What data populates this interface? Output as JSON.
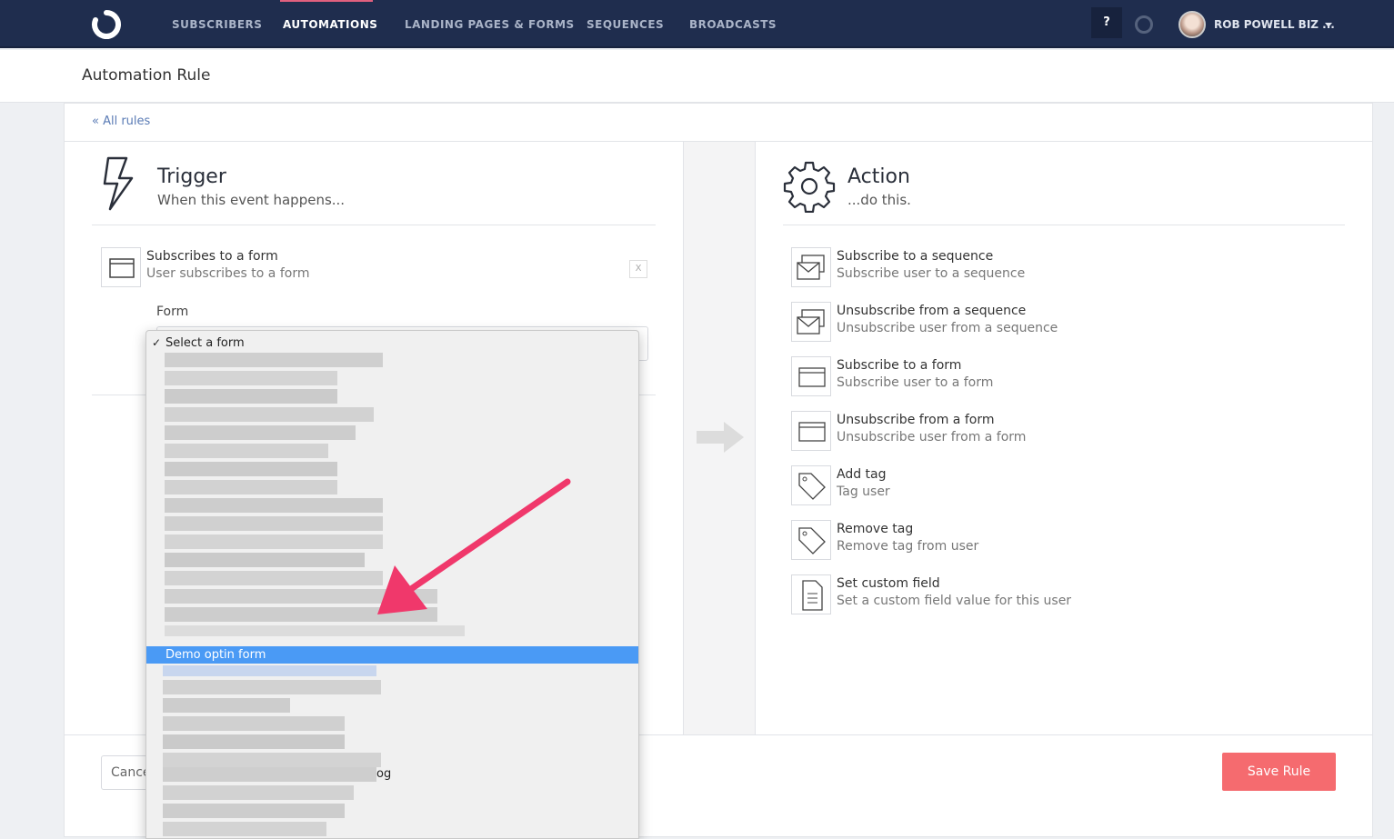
{
  "nav": {
    "items": [
      "SUBSCRIBERS",
      "AUTOMATIONS",
      "LANDING PAGES & FORMS",
      "SEQUENCES",
      "BROADCASTS"
    ],
    "active": "AUTOMATIONS",
    "help": "?",
    "user": "ROB POWELL BIZ ..."
  },
  "header": {
    "title": "Automation Rule"
  },
  "back_link": "« All rules",
  "trigger": {
    "title": "Trigger",
    "subtitle": "When this event happens...",
    "selected": {
      "title": "Subscribes to a form",
      "subtitle": "User subscribes to a form",
      "remove": "X"
    },
    "form_label": "Form"
  },
  "action": {
    "title": "Action",
    "subtitle": "...do this.",
    "options": [
      {
        "title": "Subscribe to a sequence",
        "subtitle": "Subscribe user to a sequence",
        "icon": "sequence-icon"
      },
      {
        "title": "Unsubscribe from a sequence",
        "subtitle": "Unsubscribe user from a sequence",
        "icon": "sequence-icon"
      },
      {
        "title": "Subscribe to a form",
        "subtitle": "Subscribe user to a form",
        "icon": "form-icon"
      },
      {
        "title": "Unsubscribe from a form",
        "subtitle": "Unsubscribe user from a form",
        "icon": "form-icon"
      },
      {
        "title": "Add tag",
        "subtitle": "Tag user",
        "icon": "tag-icon"
      },
      {
        "title": "Remove tag",
        "subtitle": "Remove tag from user",
        "icon": "tag-icon"
      },
      {
        "title": "Set custom field",
        "subtitle": "Set a custom field value for this user",
        "icon": "document-icon"
      }
    ]
  },
  "dropdown": {
    "placeholder": "Select a form",
    "highlighted": "Demo optin form",
    "partial_text": "og"
  },
  "footer": {
    "cancel": "Cancel",
    "save": "Save Rule"
  },
  "colors": {
    "nav": "#1f2d4e",
    "save": "#f56b6f",
    "highlight": "#4a9af5",
    "arrow": "#f0386b"
  }
}
